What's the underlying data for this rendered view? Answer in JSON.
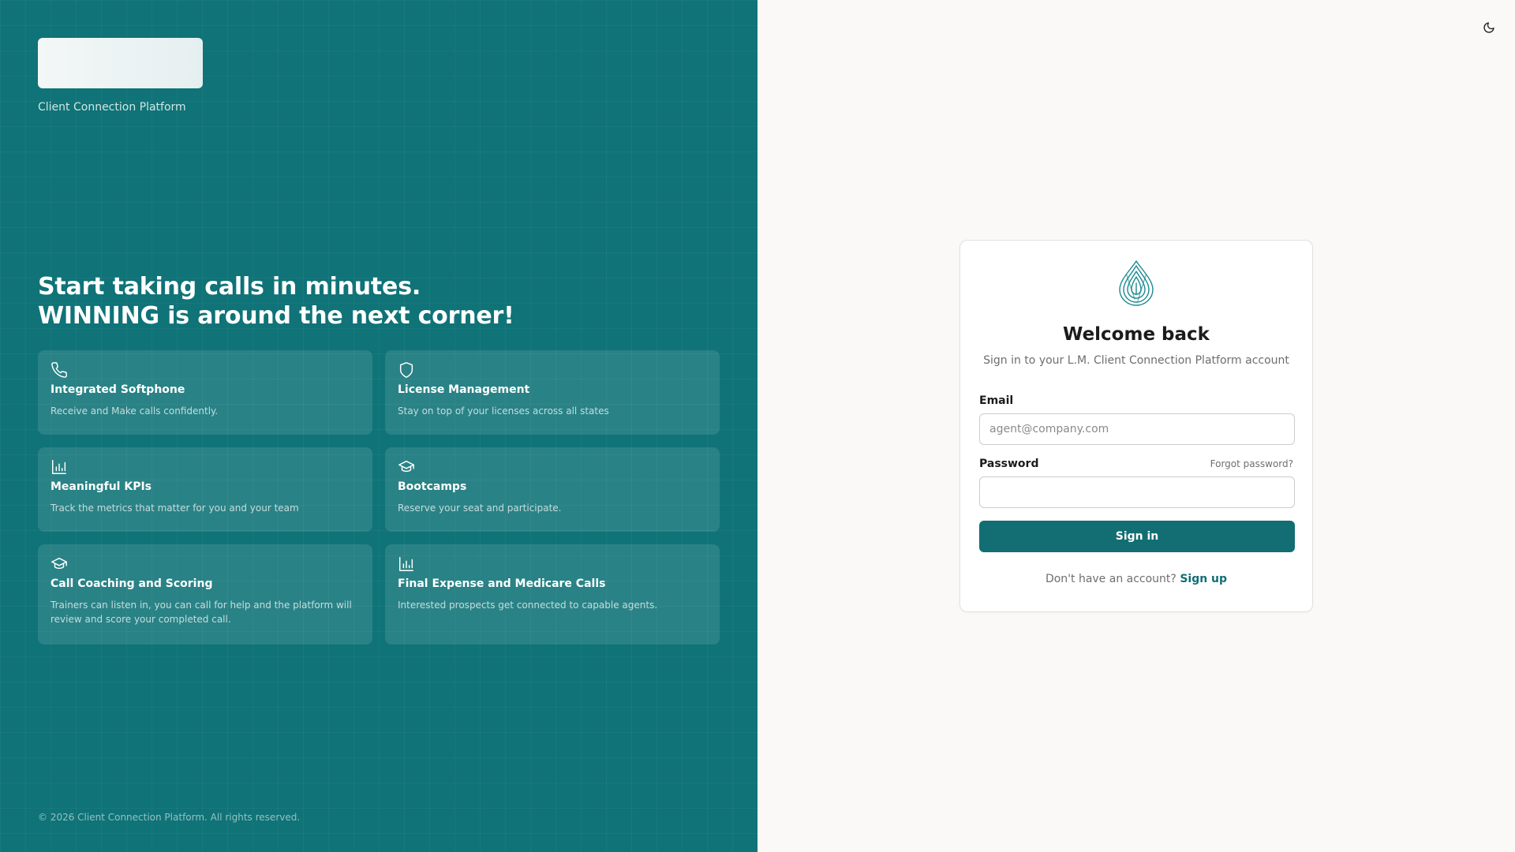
{
  "brand": {
    "tagline": "Client Connection Platform"
  },
  "hero": {
    "line1": "Start taking calls in minutes.",
    "line2": "WINNING is around the next corner!"
  },
  "features": [
    {
      "icon": "phone-icon",
      "title": "Integrated Softphone",
      "desc": "Receive and Make calls confidently."
    },
    {
      "icon": "shield-icon",
      "title": "License Management",
      "desc": "Stay on top of your licenses across all states"
    },
    {
      "icon": "bar-chart-icon",
      "title": "Meaningful KPIs",
      "desc": "Track the metrics that matter for you and your team"
    },
    {
      "icon": "graduation-cap-icon",
      "title": "Bootcamps",
      "desc": "Reserve your seat and participate."
    },
    {
      "icon": "graduation-cap-icon",
      "title": "Call Coaching and Scoring",
      "desc": "Trainers can listen in, you can call for help and the platform will review and score your completed call."
    },
    {
      "icon": "bar-chart-icon",
      "title": "Final Expense and Medicare Calls",
      "desc": "Interested prospects get connected to capable agents."
    }
  ],
  "footer": {
    "copyright": "© 2026 Client Connection Platform. All rights reserved."
  },
  "login": {
    "logo_icon": "fingerprint-drop-icon",
    "title": "Welcome back",
    "subtitle": "Sign in to your L.M. Client Connection Platform account",
    "email_label": "Email",
    "email_placeholder": "agent@company.com",
    "email_value": "",
    "password_label": "Password",
    "password_value": "",
    "forgot_label": "Forgot password?",
    "signin_label": "Sign in",
    "signup_prompt": "Don't have an account?",
    "signup_label": "Sign up"
  },
  "theme_toggle": {
    "icon": "moon-icon"
  },
  "colors": {
    "panel": "#0f7377",
    "accent": "#126e73",
    "background": "#faf9f7"
  }
}
